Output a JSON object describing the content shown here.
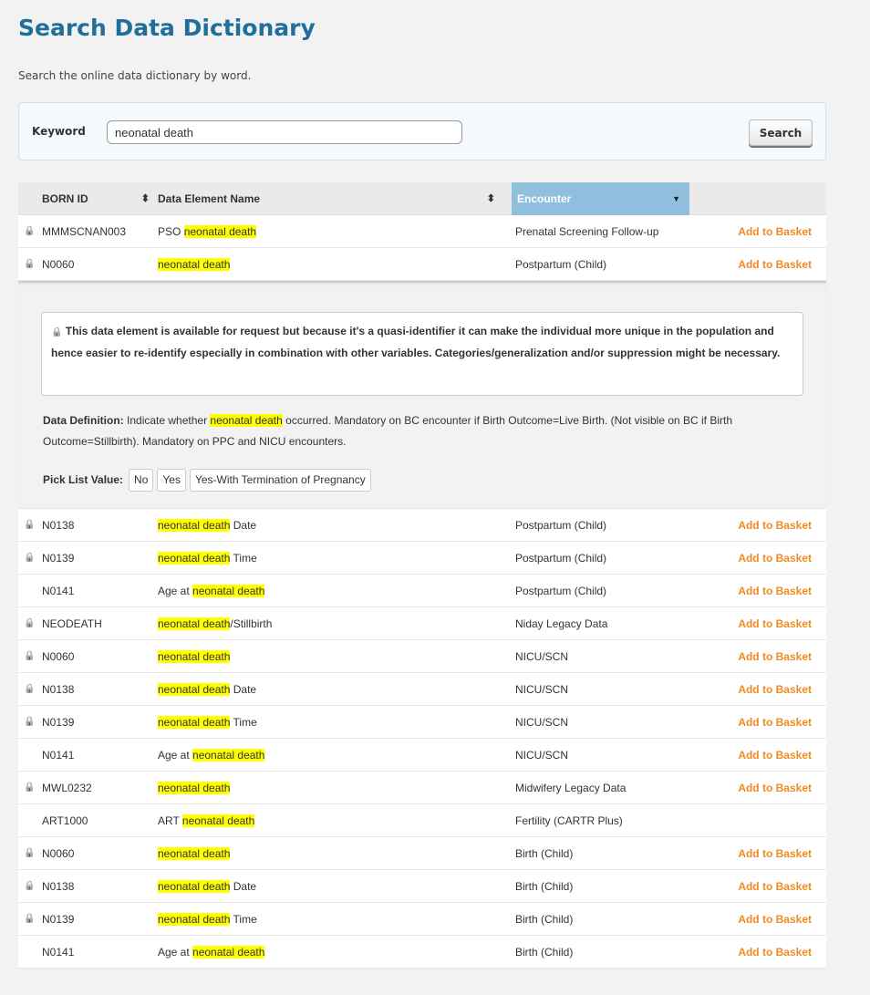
{
  "page": {
    "title": "Search Data Dictionary",
    "intro": "Search the online data dictionary by word."
  },
  "search": {
    "keyword_label": "Keyword",
    "keyword_value": "neonatal death",
    "button_label": "Search"
  },
  "table": {
    "headers": {
      "born_id": "BORN ID",
      "name": "Data Element Name",
      "encounter": "Encounter"
    },
    "sort_icon": "sort-updown-icon",
    "dropdown_icon": "caret-down-icon",
    "lock_icon": "lock-icon",
    "add_label": "Add to Basket",
    "rows": [
      {
        "locked": true,
        "id": "MMMSCNAN003",
        "pre": "PSO ",
        "hl": "neonatal death",
        "post": "",
        "enc": "Prenatal Screening Follow-up",
        "add": true
      },
      {
        "locked": true,
        "id": "N0060",
        "pre": "",
        "hl": "neonatal death",
        "post": "",
        "enc": "Postpartum (Child)",
        "add": true
      },
      {
        "locked": true,
        "id": "N0138",
        "pre": "",
        "hl": "neonatal death",
        "post": " Date",
        "enc": "Postpartum (Child)",
        "add": true
      },
      {
        "locked": true,
        "id": "N0139",
        "pre": "",
        "hl": "neonatal death",
        "post": " Time",
        "enc": "Postpartum (Child)",
        "add": true
      },
      {
        "locked": false,
        "id": "N0141",
        "pre": "Age at ",
        "hl": "neonatal death",
        "post": "",
        "enc": "Postpartum (Child)",
        "add": true
      },
      {
        "locked": true,
        "id": "NEODEATH",
        "pre": "",
        "hl": "neonatal death",
        "post": "/Stillbirth",
        "enc": "Niday Legacy Data",
        "add": true
      },
      {
        "locked": true,
        "id": "N0060",
        "pre": "",
        "hl": "neonatal death",
        "post": "",
        "enc": "NICU/SCN",
        "add": true
      },
      {
        "locked": true,
        "id": "N0138",
        "pre": "",
        "hl": "neonatal death",
        "post": " Date",
        "enc": "NICU/SCN",
        "add": true
      },
      {
        "locked": true,
        "id": "N0139",
        "pre": "",
        "hl": "neonatal death",
        "post": " Time",
        "enc": "NICU/SCN",
        "add": true
      },
      {
        "locked": false,
        "id": "N0141",
        "pre": "Age at ",
        "hl": "neonatal death",
        "post": "",
        "enc": "NICU/SCN",
        "add": true
      },
      {
        "locked": true,
        "id": "MWL0232",
        "pre": "",
        "hl": "neonatal death",
        "post": "",
        "enc": "Midwifery Legacy Data",
        "add": true
      },
      {
        "locked": false,
        "id": "ART1000",
        "pre": "ART ",
        "hl": "neonatal death",
        "post": "",
        "enc": "Fertility (CARTR Plus)",
        "add": false
      },
      {
        "locked": true,
        "id": "N0060",
        "pre": "",
        "hl": "neonatal death",
        "post": "",
        "enc": "Birth (Child)",
        "add": true
      },
      {
        "locked": true,
        "id": "N0138",
        "pre": "",
        "hl": "neonatal death",
        "post": " Date",
        "enc": "Birth (Child)",
        "add": true
      },
      {
        "locked": true,
        "id": "N0139",
        "pre": "",
        "hl": "neonatal death",
        "post": " Time",
        "enc": "Birth (Child)",
        "add": true
      },
      {
        "locked": false,
        "id": "N0141",
        "pre": "Age at ",
        "hl": "neonatal death",
        "post": "",
        "enc": "Birth (Child)",
        "add": true
      }
    ]
  },
  "detail": {
    "notice": "This data element is available for request but because it's a quasi-identifier it can make the individual more unique in the population and hence easier to re-identify especially in combination with other variables. Categories/generalization and/or suppression might be necessary.",
    "definition_label": "Data Definition:",
    "definition_pre": " Indicate whether ",
    "definition_hl": "neonatal death",
    "definition_post": " occurred. Mandatory on BC encounter if Birth Outcome=Live Birth. (Not visible on BC if Birth Outcome=Stillbirth). Mandatory on PPC and NICU encounters.",
    "picklist_label": "Pick List Value:",
    "picklist": [
      "No",
      "Yes",
      "Yes-With Termination of Pregnancy"
    ]
  },
  "colors": {
    "title": "#1f6f9a",
    "accent_header": "#8fbfdc",
    "add_link": "#f08a24",
    "highlight": "#ffff00"
  }
}
